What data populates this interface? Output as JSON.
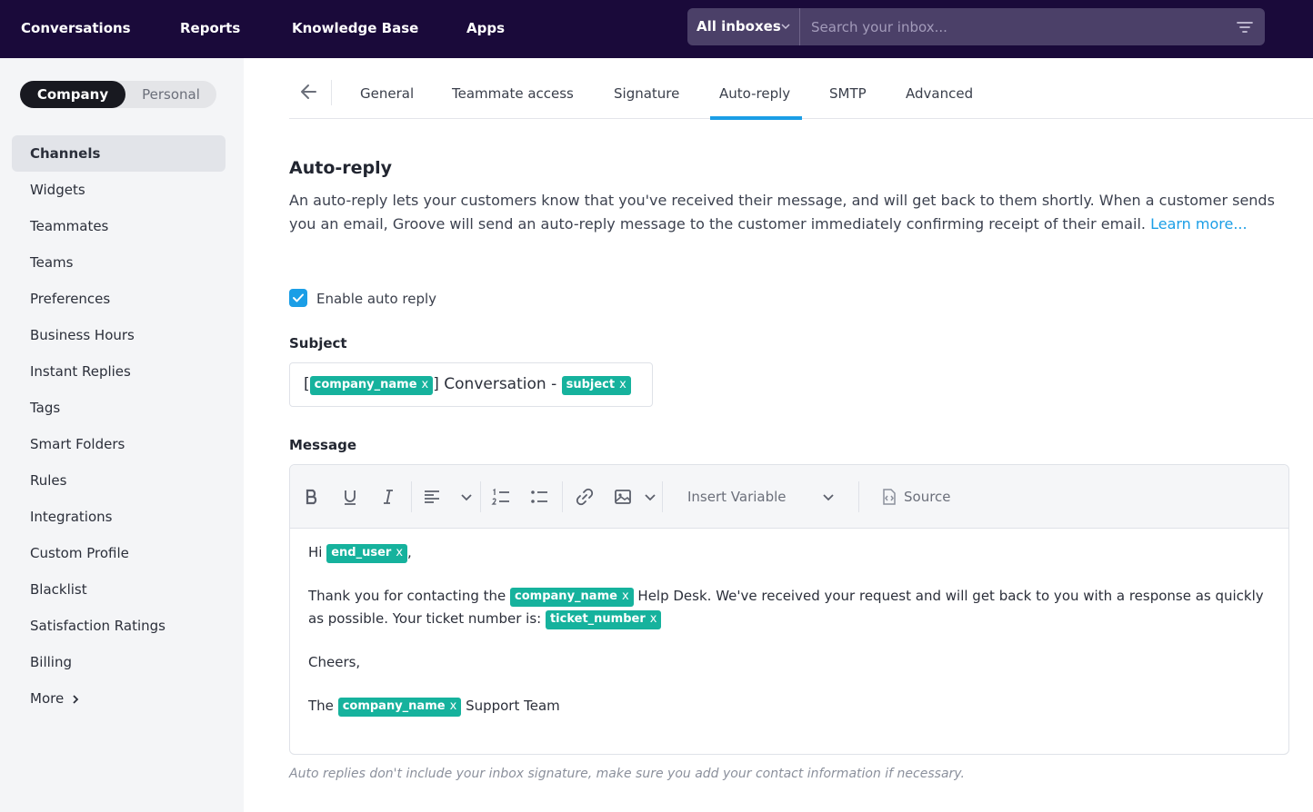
{
  "topbar": {
    "nav": [
      "Conversations",
      "Reports",
      "Knowledge Base",
      "Apps"
    ],
    "inbox_select": "All inboxes",
    "search_placeholder": "Search your inbox..."
  },
  "sidebar": {
    "segment": {
      "active": "Company",
      "inactive": "Personal"
    },
    "items": [
      {
        "label": "Channels",
        "active": true
      },
      {
        "label": "Widgets"
      },
      {
        "label": "Teammates"
      },
      {
        "label": "Teams"
      },
      {
        "label": "Preferences"
      },
      {
        "label": "Business Hours"
      },
      {
        "label": "Instant Replies"
      },
      {
        "label": "Tags"
      },
      {
        "label": "Smart Folders"
      },
      {
        "label": "Rules"
      },
      {
        "label": "Integrations"
      },
      {
        "label": "Custom Profile"
      },
      {
        "label": "Blacklist"
      },
      {
        "label": "Satisfaction Ratings"
      },
      {
        "label": "Billing"
      },
      {
        "label": "More"
      }
    ]
  },
  "tabs": [
    "General",
    "Teammate access",
    "Signature",
    "Auto-reply",
    "SMTP",
    "Advanced"
  ],
  "active_tab": "Auto-reply",
  "page": {
    "title": "Auto-reply",
    "description": "An auto-reply lets your customers know that you've received their message, and will get back to them shortly. When a customer sends you an email, Groove will send an auto-reply message to the customer immediately confirming receipt of their email.",
    "learn_more": "Learn more...",
    "enable_label": "Enable auto reply",
    "enable_checked": true,
    "subject_label": "Subject",
    "subject": {
      "open_bracket": "[",
      "var1": "company_name",
      "middle": "] Conversation -",
      "var2": "subject"
    },
    "message_label": "Message",
    "toolbar": {
      "insert_variable": "Insert Variable",
      "source": "Source"
    },
    "message": {
      "greeting": "Hi",
      "greeting_var": "end_user",
      "greeting_end": ",",
      "line2_a": "Thank you for contacting the",
      "line2_var": "company_name",
      "line2_b": "Help Desk. We've received your request and will get back to you with a response as quickly as possible. Your ticket number is:",
      "line2_var2": "ticket_number",
      "signoff": "Cheers,",
      "team_a": "The",
      "team_var": "company_name",
      "team_b": "Support Team"
    },
    "chip_x": "x",
    "note": "Auto replies don't include your inbox signature, make sure you add your contact information if necessary."
  },
  "colors": {
    "topbar": "#1a0a3a",
    "accent": "#1b9ee6",
    "chip": "#16b29d"
  }
}
